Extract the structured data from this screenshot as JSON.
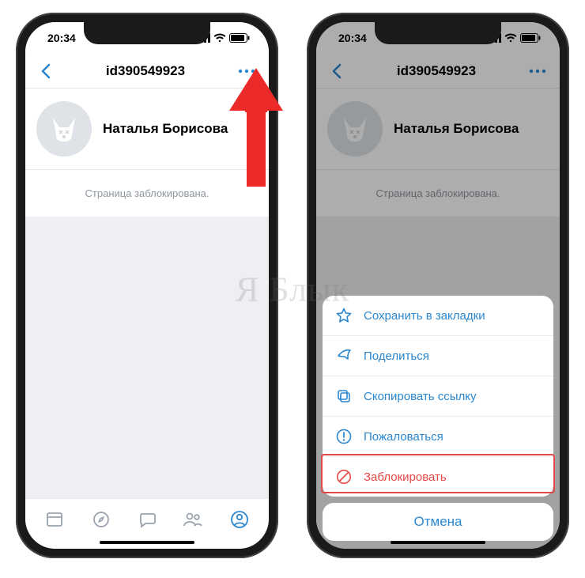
{
  "status": {
    "time": "20:34"
  },
  "header": {
    "title": "id390549923"
  },
  "profile": {
    "name": "Наталья Борисова"
  },
  "message": {
    "blocked": "Страница заблокирована."
  },
  "sheet": {
    "items": [
      {
        "label": "Сохранить в закладки"
      },
      {
        "label": "Поделиться"
      },
      {
        "label": "Скопировать ссылку"
      },
      {
        "label": "Пожаловаться"
      },
      {
        "label": "Заблокировать"
      }
    ],
    "cancel": "Отмена"
  },
  "watermark": "Я Блык"
}
